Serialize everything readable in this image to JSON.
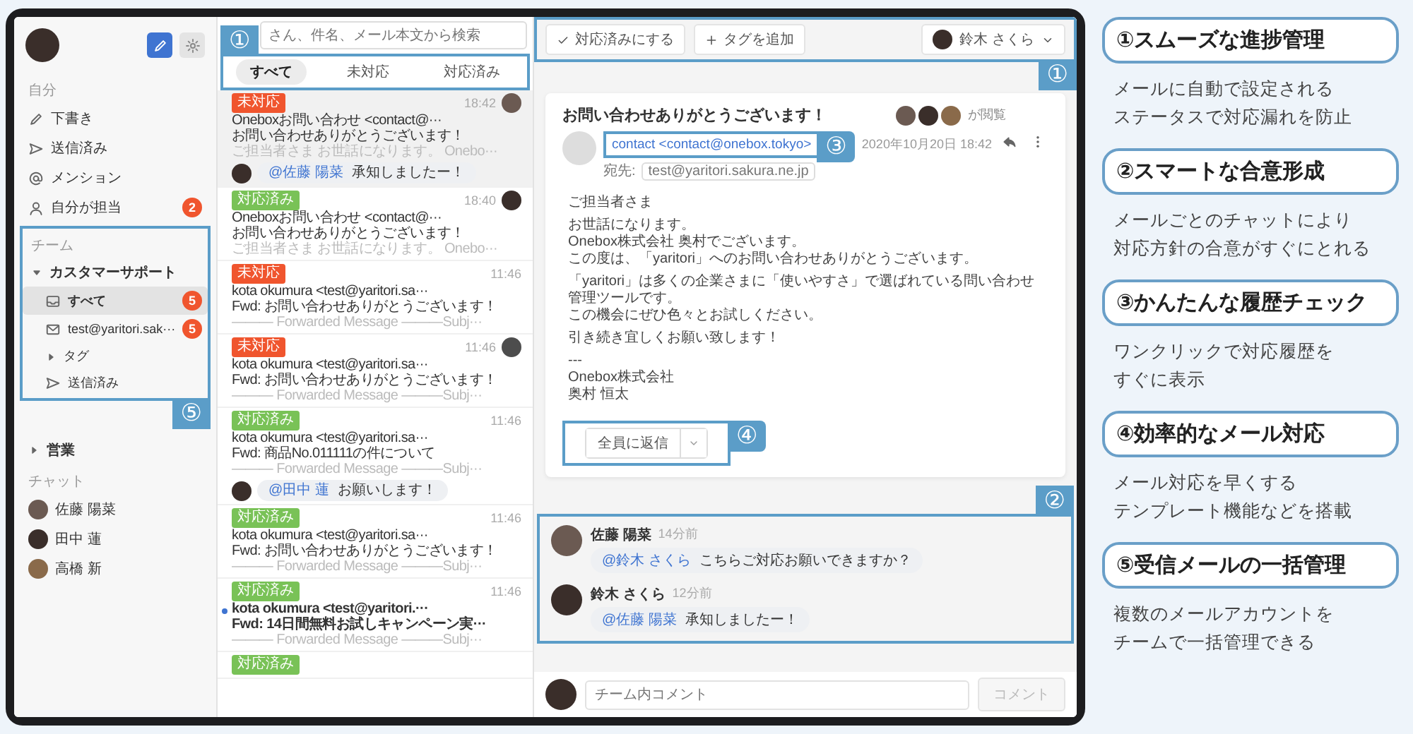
{
  "sidebar": {
    "personal_heading": "自分",
    "personal_items": [
      {
        "label": "下書き",
        "kind": "draft"
      },
      {
        "label": "送信済み",
        "kind": "sent"
      },
      {
        "label": "メンション",
        "kind": "mention"
      },
      {
        "label": "自分が担当",
        "kind": "mine",
        "badge": "2"
      }
    ],
    "team_heading": "チーム",
    "teams": [
      {
        "label": "カスタマーサポート",
        "expanded": true,
        "children": [
          {
            "label": "すべて",
            "kind": "all",
            "badge": "5",
            "selected": true
          },
          {
            "label": "test@yaritori.sak···",
            "kind": "account",
            "badge": "5",
            "selected": false
          },
          {
            "label": "タグ",
            "kind": "tag",
            "selected": false
          },
          {
            "label": "送信済み",
            "kind": "sent",
            "selected": false
          }
        ]
      },
      {
        "label": "営業",
        "expanded": false
      }
    ],
    "team_callout": "⑤",
    "chat_heading": "チャット",
    "chat_members": [
      {
        "name": "佐藤 陽菜"
      },
      {
        "name": "田中 蓮"
      },
      {
        "name": "高橋 新"
      }
    ]
  },
  "message_list": {
    "search": {
      "placeholder": "さん、件名、メール本文から検索"
    },
    "callout": "①",
    "tabs": [
      {
        "label": "すべて",
        "selected": true
      },
      {
        "label": "未対応",
        "selected": false
      },
      {
        "label": "対応済み",
        "selected": false
      }
    ],
    "items": [
      {
        "status": {
          "kind": "open",
          "label": "未対応"
        },
        "selected": true,
        "unread": false,
        "assignee_avatar": true,
        "from": "Oneboxお問い合わせ <contact@···",
        "time": "18:42",
        "subject": "お問い合わせありがとうございます！",
        "preview": "ご担当者さま お世話になります。 Onebo···",
        "comment": {
          "mention": "@佐藤 陽菜",
          "text": "承知しましたー！"
        }
      },
      {
        "status": {
          "kind": "done",
          "label": "対応済み"
        },
        "selected": false,
        "unread": false,
        "assignee_avatar": true,
        "from": "Oneboxお問い合わせ <contact@···",
        "time": "18:40",
        "subject": "お問い合わせありがとうございます！",
        "preview": "ご担当者さま お世話になります。 Onebo···"
      },
      {
        "status": {
          "kind": "open",
          "label": "未対応"
        },
        "selected": false,
        "unread": false,
        "assignee_avatar": false,
        "from": "kota okumura <test@yaritori.sa···",
        "time": "11:46",
        "subject": "Fwd: お問い合わせありがとうございます！",
        "preview": "——— Forwarded Message ———Subj···"
      },
      {
        "status": {
          "kind": "open",
          "label": "未対応"
        },
        "selected": false,
        "unread": false,
        "assignee_avatar": true,
        "from": "kota okumura <test@yaritori.sa···",
        "time": "11:46",
        "subject": "Fwd: お問い合わせありがとうございます！",
        "preview": "——— Forwarded Message ———Subj···"
      },
      {
        "status": {
          "kind": "done",
          "label": "対応済み"
        },
        "selected": false,
        "unread": false,
        "assignee_avatar": false,
        "from": "kota okumura <test@yaritori.sa···",
        "time": "11:46",
        "subject": "Fwd: 商品No.011111の件について",
        "preview": "——— Forwarded Message ———Subj···",
        "comment": {
          "mention": "@田中 蓮",
          "text": "お願いします！"
        }
      },
      {
        "status": {
          "kind": "done",
          "label": "対応済み"
        },
        "selected": false,
        "unread": false,
        "assignee_avatar": false,
        "from": "kota okumura <test@yaritori.sa···",
        "time": "11:46",
        "subject": "Fwd: お問い合わせありがとうございます！",
        "preview": "——— Forwarded Message ———Subj···"
      },
      {
        "status": {
          "kind": "done",
          "label": "対応済み"
        },
        "selected": false,
        "unread": true,
        "assignee_avatar": false,
        "from": "kota okumura <test@yaritori.···",
        "time": "11:46",
        "subject": "Fwd: 14日間無料お試しキャンペーン実···",
        "preview": "——— Forwarded Message ———Subj···"
      },
      {
        "status": {
          "kind": "done",
          "label": "対応済み"
        },
        "selected": false,
        "unread": false,
        "assignee_avatar": false
      }
    ]
  },
  "toolbar": {
    "mark_done": "対応済みにする",
    "add_tag": "タグを追加",
    "assignee": "鈴木 さくら",
    "callout": "①"
  },
  "email": {
    "subject": "お問い合わせありがとうございます！",
    "viewed_label": "が閲覧",
    "from": "contact <contact@onebox.tokyo>",
    "from_callout": "③",
    "to_label": "宛先:",
    "to": "test@yaritori.sakura.ne.jp",
    "date": "2020年10月20日 18:42",
    "body": [
      [
        "ご担当者さま"
      ],
      [
        "お世話になります。",
        "Onebox株式会社 奥村でございます。",
        "この度は、「yaritori」へのお問い合わせありがとうございます。"
      ],
      [
        "「yaritori」は多くの企業さまに「使いやすさ」で選ばれている問い合わせ管理ツールです。",
        "この機会にぜひ色々とお試しください。"
      ],
      [
        "引き続き宜しくお願い致します！"
      ],
      [
        "---",
        "Onebox株式会社",
        "奥村 恒太"
      ]
    ],
    "reply_button": "全員に返信",
    "reply_callout": "④"
  },
  "team_chat": {
    "callout": "②",
    "messages": [
      {
        "name": "佐藤 陽菜",
        "time": "14分前",
        "mention": "@鈴木 さくら",
        "text": "こちらご対応お願いできますか？"
      },
      {
        "name": "鈴木 さくら",
        "time": "12分前",
        "mention": "@佐藤 陽菜",
        "text": "承知しましたー！"
      }
    ],
    "comment": {
      "placeholder": "チーム内コメント",
      "button": "コメント",
      "disabled": true
    }
  },
  "features": [
    {
      "title": "①スムーズな進捗管理",
      "description": [
        "メールに自動で設定される",
        "ステータスで対応漏れを防止"
      ]
    },
    {
      "title": "②スマートな合意形成",
      "description": [
        "メールごとのチャットにより",
        "対応方針の合意がすぐにとれる"
      ]
    },
    {
      "title": "③かんたんな履歴チェック",
      "description": [
        "ワンクリックで対応履歴を",
        "すぐに表示"
      ]
    },
    {
      "title": "④効率的なメール対応",
      "description": [
        "メール対応を早くする",
        "テンプレート機能などを搭載"
      ]
    },
    {
      "title": "⑤受信メールの一括管理",
      "description": [
        "複数のメールアカウントを",
        "チームで一括管理できる"
      ]
    }
  ]
}
